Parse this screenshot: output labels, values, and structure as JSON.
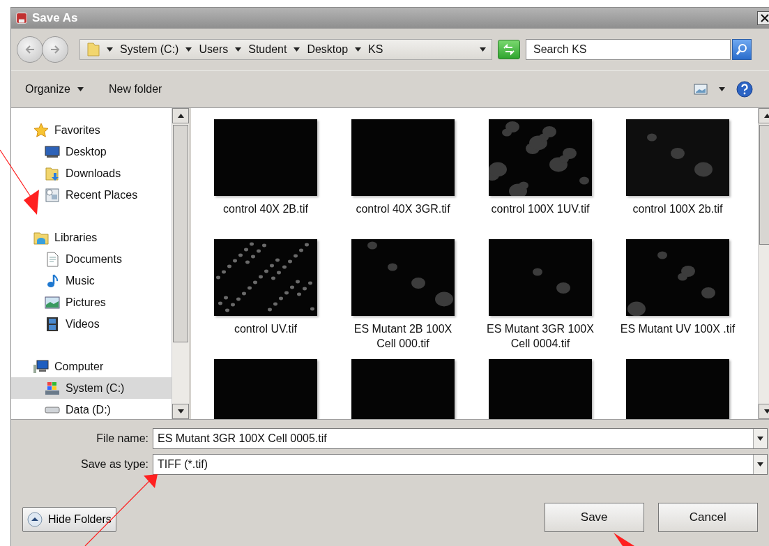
{
  "window": {
    "title": "Save As"
  },
  "address_bar": {
    "crumbs": [
      "System (C:)",
      "Users",
      "Student",
      "Desktop",
      "KS"
    ]
  },
  "search": {
    "placeholder": "Search KS"
  },
  "toolbar": {
    "organize": "Organize",
    "new_folder": "New folder"
  },
  "navigation": [
    {
      "label": "Favorites",
      "selected": false,
      "children": [
        {
          "label": "Desktop",
          "selected": false
        },
        {
          "label": "Downloads",
          "selected": false
        },
        {
          "label": "Recent Places",
          "selected": false
        }
      ]
    },
    {
      "label": "Libraries",
      "selected": false,
      "children": [
        {
          "label": "Documents",
          "selected": false
        },
        {
          "label": "Music",
          "selected": false
        },
        {
          "label": "Pictures",
          "selected": false
        },
        {
          "label": "Videos",
          "selected": false
        }
      ]
    },
    {
      "label": "Computer",
      "selected": false,
      "children": [
        {
          "label": "System (C:)",
          "selected": true
        },
        {
          "label": "Data (D:)",
          "selected": false
        }
      ]
    }
  ],
  "files": [
    {
      "kind": "file",
      "name": "control 40X 2B.tif"
    },
    {
      "kind": "file",
      "name": "control 40X 3GR.tif"
    },
    {
      "kind": "file",
      "name": "control 100X 1UV.tif"
    },
    {
      "kind": "file",
      "name": "control 100X 2b.tif"
    },
    {
      "kind": "file",
      "name": "control UV.tif"
    },
    {
      "kind": "file",
      "name": "ES Mutant 2B 100X Cell 000.tif"
    },
    {
      "kind": "file",
      "name": "ES Mutant 3GR 100X Cell 0004.tif"
    },
    {
      "kind": "file",
      "name": "ES Mutant UV 100X .tif"
    },
    {
      "kind": "cut-off"
    },
    {
      "kind": "cut-off"
    },
    {
      "kind": "cut-off"
    },
    {
      "kind": "cut-off"
    }
  ],
  "file_name": {
    "label": "File name:",
    "value": "ES Mutant 3GR 100X Cell 0005.tif"
  },
  "save_as_type": {
    "label": "Save as type:",
    "value": "TIFF (*.tif)"
  },
  "hide_folders": "Hide Folders",
  "buttons": [
    "Save",
    "Cancel"
  ]
}
